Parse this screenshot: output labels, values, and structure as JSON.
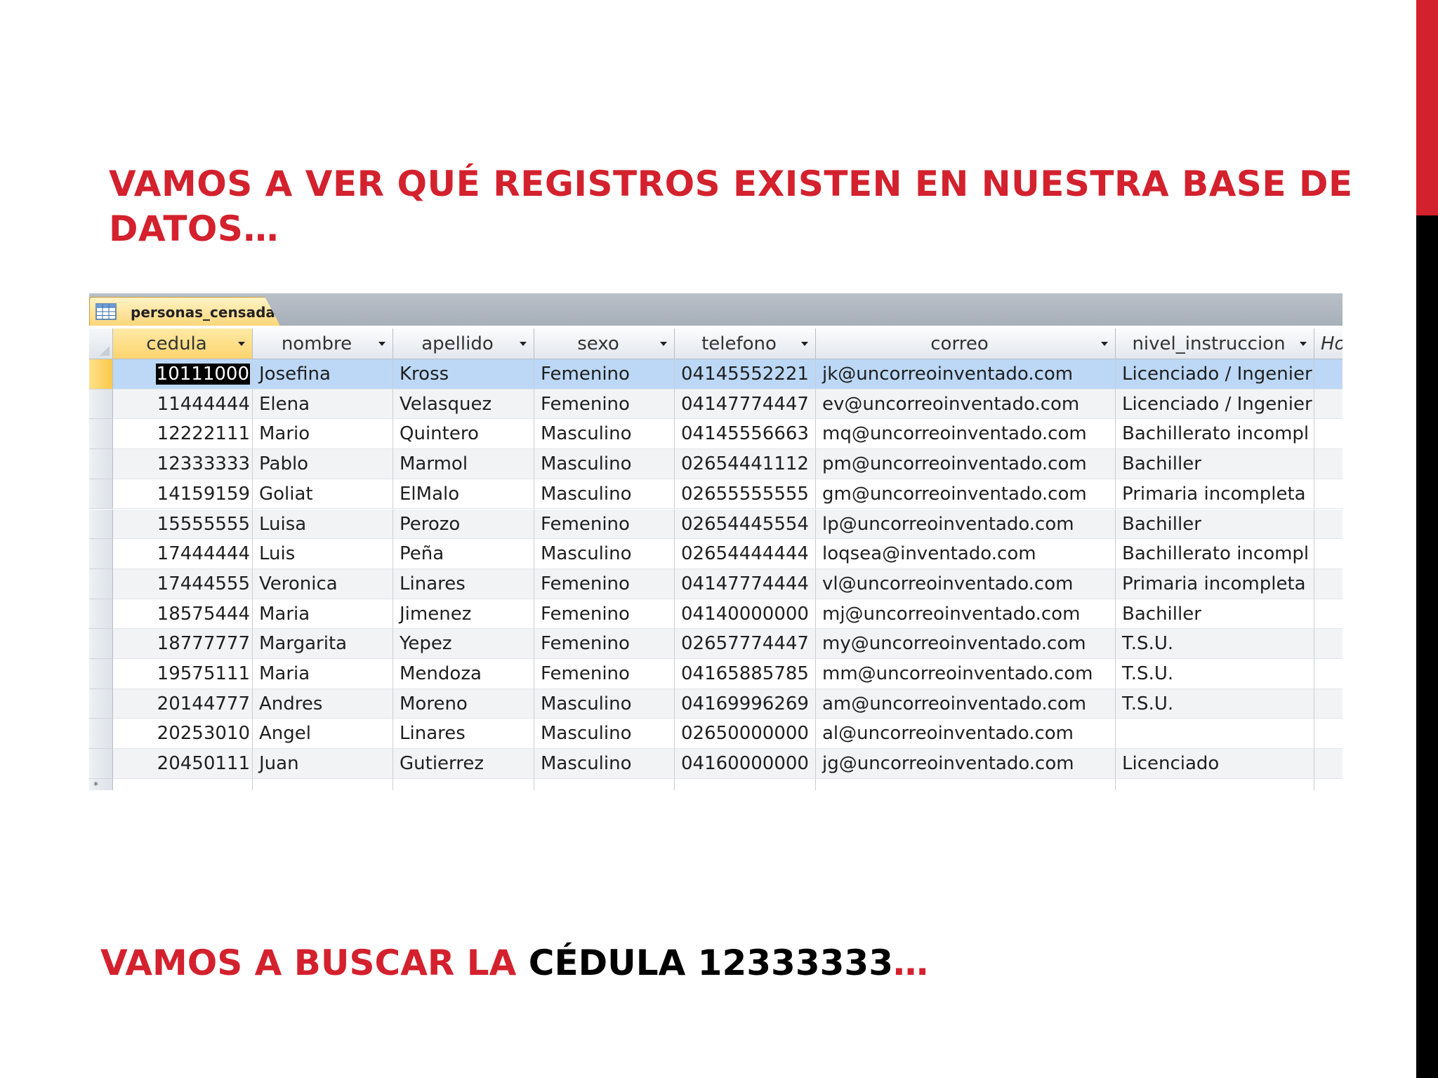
{
  "slide": {
    "heading": "VAMOS A VER QUÉ REGISTROS EXISTEN EN NUESTRA BASE DE DATOS…",
    "footer_red": "VAMOS A BUSCAR LA ",
    "footer_black": "CÉDULA 12333333",
    "footer_end": "…",
    "accent_red": "#d3212d"
  },
  "datasheet": {
    "tab_label": "personas_censadas",
    "tab_icon": "table-icon",
    "columns": [
      "cedula",
      "nombre",
      "apellido",
      "sexo",
      "telefono",
      "correo",
      "nivel_instruccion",
      "Ho"
    ],
    "rows": [
      [
        "10111000",
        "Josefina",
        "Kross",
        "Femenino",
        "04145552221",
        "jk@uncorreoinventado.com",
        "Licenciado / Ingenier"
      ],
      [
        "11444444",
        "Elena",
        "Velasquez",
        "Femenino",
        "04147774447",
        "ev@uncorreoinventado.com",
        "Licenciado / Ingenier"
      ],
      [
        "12222111",
        "Mario",
        "Quintero",
        "Masculino",
        "04145556663",
        "mq@uncorreoinventado.com",
        "Bachillerato incompl"
      ],
      [
        "12333333",
        "Pablo",
        "Marmol",
        "Masculino",
        "02654441112",
        "pm@uncorreoinventado.com",
        "Bachiller"
      ],
      [
        "14159159",
        "Goliat",
        "ElMalo",
        "Masculino",
        "02655555555",
        "gm@uncorreoinventado.com",
        "Primaria incompleta"
      ],
      [
        "15555555",
        "Luisa",
        "Perozo",
        "Femenino",
        "02654445554",
        "lp@uncorreoinventado.com",
        "Bachiller"
      ],
      [
        "17444444",
        "Luis",
        "Peña",
        "Masculino",
        "02654444444",
        "loqsea@inventado.com",
        "Bachillerato incompl"
      ],
      [
        "17444555",
        "Veronica",
        "Linares",
        "Femenino",
        "04147774444",
        "vl@uncorreoinventado.com",
        "Primaria incompleta"
      ],
      [
        "18575444",
        "Maria",
        "Jimenez",
        "Femenino",
        "04140000000",
        "mj@uncorreoinventado.com",
        "Bachiller"
      ],
      [
        "18777777",
        "Margarita",
        "Yepez",
        "Femenino",
        "02657774447",
        "my@uncorreoinventado.com",
        "T.S.U."
      ],
      [
        "19575111",
        "Maria",
        "Mendoza",
        "Femenino",
        "04165885785",
        "mm@uncorreoinventado.com",
        "T.S.U."
      ],
      [
        "20144777",
        "Andres",
        "Moreno",
        "Masculino",
        "04169996269",
        "am@uncorreoinventado.com",
        "T.S.U."
      ],
      [
        "20253010",
        "Angel",
        "Linares",
        "Masculino",
        "02650000000",
        "al@uncorreoinventado.com",
        ""
      ],
      [
        "20450111",
        "Juan",
        "Gutierrez",
        "Masculino",
        "04160000000",
        "jg@uncorreoinventado.com",
        "Licenciado"
      ]
    ],
    "new_record_marker": "*",
    "selection_color": "#bcd8f6",
    "header_selected_color": "#fcd46e"
  }
}
